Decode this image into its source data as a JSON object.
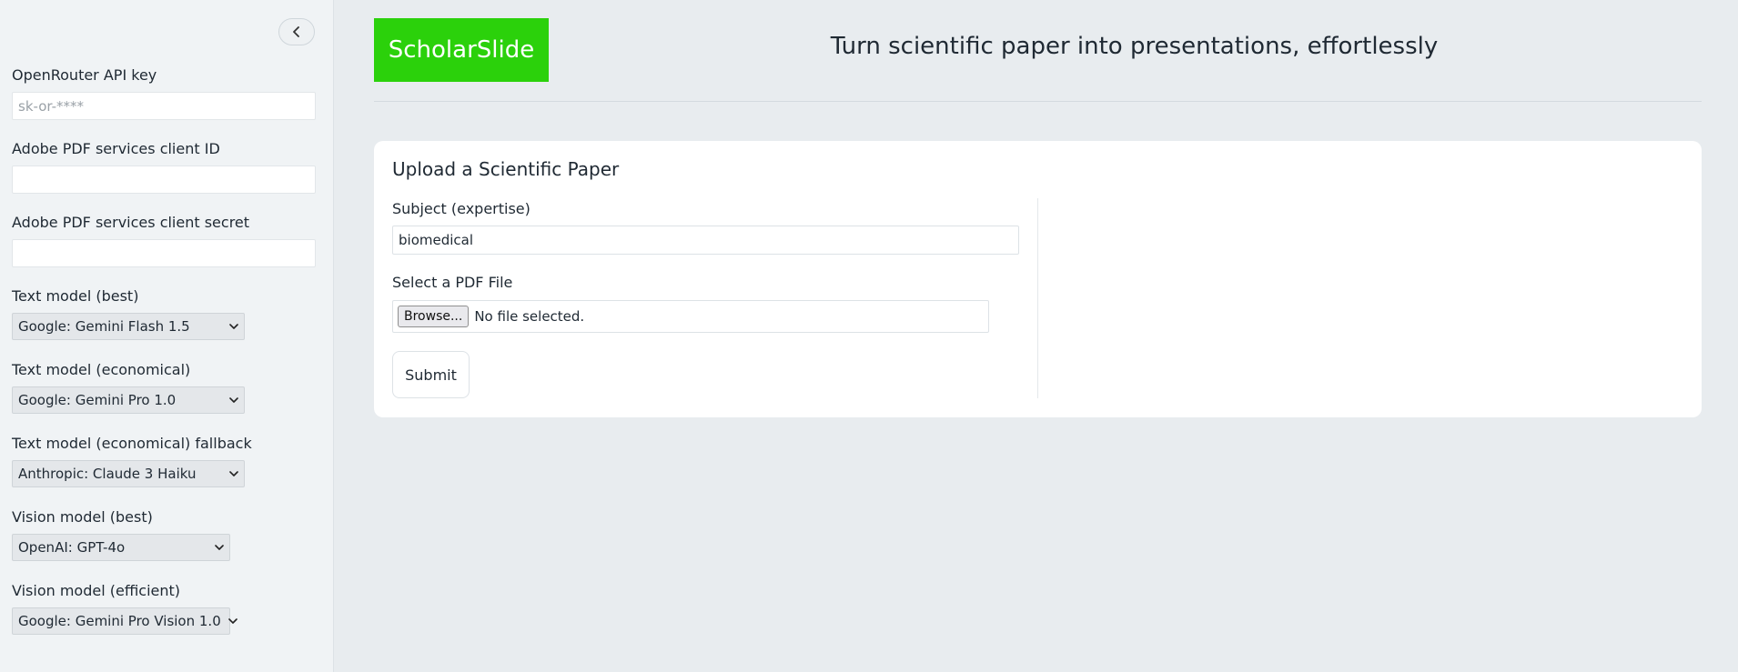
{
  "sidebar": {
    "fields": [
      {
        "label": "OpenRouter API key",
        "placeholder": "sk-or-****",
        "value": ""
      },
      {
        "label": "Adobe PDF services client ID",
        "value": ""
      },
      {
        "label": "Adobe PDF services client secret",
        "value": ""
      }
    ],
    "selects": [
      {
        "label": "Text model (best)",
        "value": "Google: Gemini Flash 1.5"
      },
      {
        "label": "Text model (economical)",
        "value": "Google: Gemini Pro 1.0"
      },
      {
        "label": "Text model (economical) fallback",
        "value": "Anthropic: Claude 3 Haiku"
      },
      {
        "label": "Vision model (best)",
        "value": "OpenAI: GPT-4o"
      },
      {
        "label": "Vision model (efficient)",
        "value": "Google: Gemini Pro Vision 1.0"
      }
    ],
    "collapse_icon": "chevron-left-icon"
  },
  "header": {
    "logo": "ScholarSlide",
    "logo_color": "#2bd10b",
    "tagline": "Turn scientific paper into presentations, effortlessly"
  },
  "upload": {
    "title": "Upload a Scientific Paper",
    "subject_label": "Subject (expertise)",
    "subject_value": "biomedical",
    "file_label": "Select a PDF File",
    "browse_label": "Browse...",
    "file_status": "No file selected.",
    "submit_label": "Submit"
  }
}
